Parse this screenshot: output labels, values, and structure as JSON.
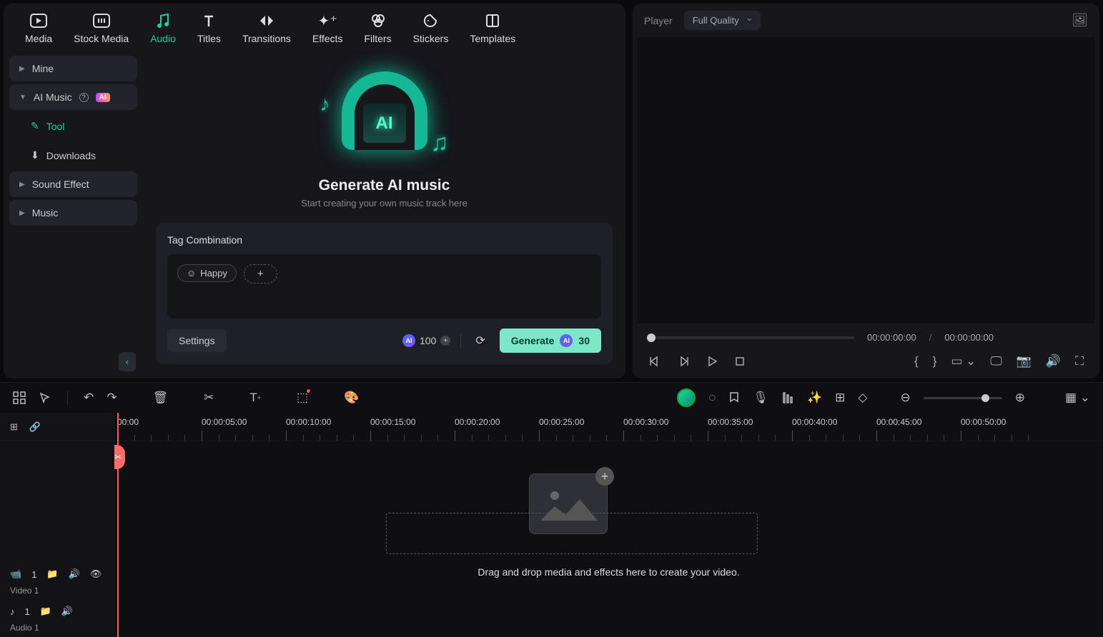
{
  "tabs": [
    {
      "label": "Media"
    },
    {
      "label": "Stock Media"
    },
    {
      "label": "Audio"
    },
    {
      "label": "Titles"
    },
    {
      "label": "Transitions"
    },
    {
      "label": "Effects"
    },
    {
      "label": "Filters"
    },
    {
      "label": "Stickers"
    },
    {
      "label": "Templates"
    }
  ],
  "sidebar": {
    "mine": "Mine",
    "ai_music": "AI Music",
    "tool": "Tool",
    "downloads": "Downloads",
    "sound_effect": "Sound Effect",
    "music": "Music",
    "ai_badge": "AI"
  },
  "ai_area": {
    "title": "Generate AI music",
    "subtitle": "Start creating your own music track here",
    "illus_text": "AI"
  },
  "tag_panel": {
    "title": "Tag Combination",
    "tags": [
      "Happy"
    ],
    "settings": "Settings",
    "credits": "100",
    "generate": "Generate",
    "gen_cost": "30"
  },
  "player": {
    "label": "Player",
    "quality": "Full Quality",
    "time_current": "00:00:00:00",
    "time_total": "00:00:00:00"
  },
  "timeline": {
    "marks": [
      "00:00",
      "00:00:05:00",
      "00:00:10:00",
      "00:00:15:00",
      "00:00:20:00",
      "00:00:25:00",
      "00:00:30:00",
      "00:00:35:00",
      "00:00:40:00",
      "00:00:45:00",
      "00:00:50:00"
    ],
    "drop_text": "Drag and drop media and effects here to create your video.",
    "tracks": {
      "video_num": "1",
      "video_label": "Video 1",
      "audio_num": "1",
      "audio_label": "Audio 1"
    }
  }
}
